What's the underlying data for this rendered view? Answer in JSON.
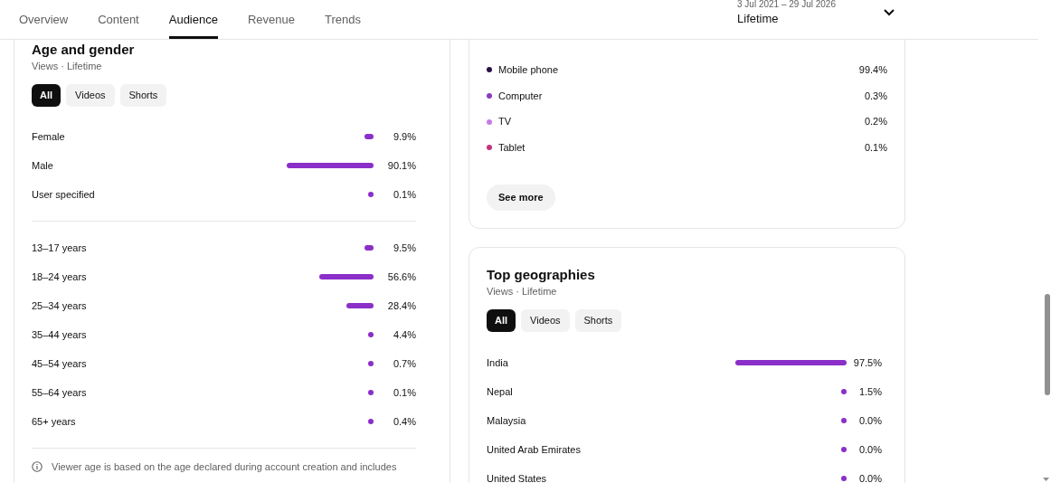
{
  "tabs": [
    {
      "label": "Overview",
      "selected": false
    },
    {
      "label": "Content",
      "selected": false
    },
    {
      "label": "Audience",
      "selected": true
    },
    {
      "label": "Revenue",
      "selected": false
    },
    {
      "label": "Trends",
      "selected": false
    }
  ],
  "date_range": {
    "range": "3 Jul 2021 – 29 Jul 2026",
    "period": "Lifetime"
  },
  "age_and_gender": {
    "title": "Age and gender",
    "subtitle": "Views · Lifetime",
    "filters": [
      {
        "label": "All",
        "selected": true
      },
      {
        "label": "Videos",
        "selected": false
      },
      {
        "label": "Shorts",
        "selected": false
      }
    ],
    "gender": [
      {
        "label": "Female",
        "value": "9.9%"
      },
      {
        "label": "Male",
        "value": "90.1%"
      },
      {
        "label": "User specified",
        "value": "0.1%"
      }
    ],
    "age": [
      {
        "label": "13–17 years",
        "value": "9.5%"
      },
      {
        "label": "18–24 years",
        "value": "56.6%"
      },
      {
        "label": "25–34 years",
        "value": "28.4%"
      },
      {
        "label": "35–44 years",
        "value": "4.4%"
      },
      {
        "label": "45–54 years",
        "value": "0.7%"
      },
      {
        "label": "55–64 years",
        "value": "0.1%"
      },
      {
        "label": "65+ years",
        "value": "0.4%"
      }
    ],
    "note": "Viewer age is based on the age declared during account creation and includes"
  },
  "device_type": {
    "items": [
      {
        "label": "Mobile phone",
        "color": "#2b0f45",
        "value": "99.4%"
      },
      {
        "label": "Computer",
        "color": "#8a3cc4",
        "value": "0.3%"
      },
      {
        "label": "TV",
        "color": "#c87ae8",
        "value": "0.2%"
      },
      {
        "label": "Tablet",
        "color": "#c4337c",
        "value": "0.1%"
      }
    ],
    "button": "See more"
  },
  "top_geographies": {
    "title": "Top geographies",
    "subtitle": "Views · Lifetime",
    "filters": [
      {
        "label": "All",
        "selected": true
      },
      {
        "label": "Videos",
        "selected": false
      },
      {
        "label": "Shorts",
        "selected": false
      }
    ],
    "rows": [
      {
        "label": "India",
        "value": "97.5%"
      },
      {
        "label": "Nepal",
        "value": "1.5%"
      },
      {
        "label": "Malaysia",
        "value": "0.0%"
      },
      {
        "label": "United Arab Emirates",
        "value": "0.0%"
      },
      {
        "label": "United States",
        "value": "0.0%"
      }
    ]
  }
}
